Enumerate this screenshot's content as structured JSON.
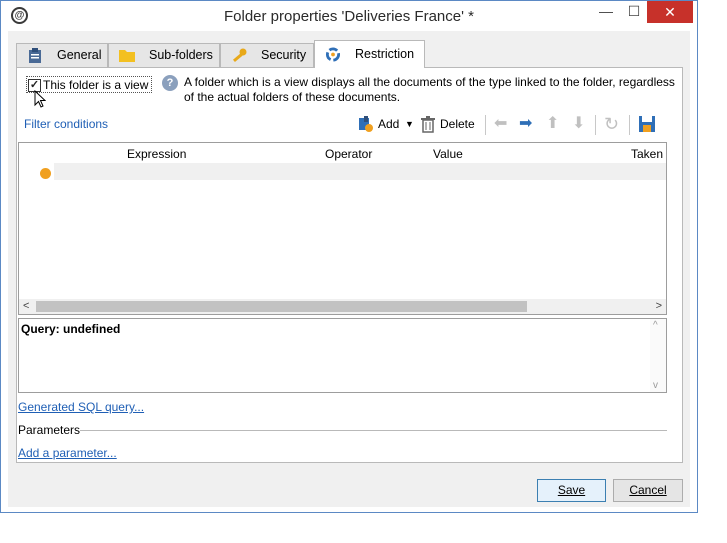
{
  "window": {
    "title": "Folder properties 'Deliveries France' *",
    "app_icon_glyph": "@",
    "minimize_glyph": "—",
    "maximize_glyph": "☐",
    "close_glyph": "✕"
  },
  "tabs": [
    {
      "label": "General",
      "icon": "clipboard-icon",
      "active": false
    },
    {
      "label": "Sub-folders",
      "icon": "folder-icon",
      "active": false
    },
    {
      "label": "Security",
      "icon": "key-icon",
      "active": false
    },
    {
      "label": "Restriction",
      "icon": "restriction-icon",
      "active": true
    }
  ],
  "restriction": {
    "view_checkbox_label": "This folder is a view",
    "view_checked": true,
    "checkbox_glyph": "✓",
    "help_glyph": "?",
    "help_text": "A folder which is a view displays all the documents of the type linked to the folder, regardless of the actual folders of these documents.",
    "filter_conditions": "Filter conditions",
    "toolbar": {
      "add_label": "Add",
      "delete_label": "Delete",
      "dropdown_glyph": "▼",
      "left_glyph": "⬅",
      "right_glyph": "➡",
      "up_glyph": "⬆",
      "down_glyph": "⬇",
      "refresh_glyph": "↻"
    },
    "grid": {
      "columns": [
        "Expression",
        "Operator",
        "Value",
        "Taken"
      ],
      "scroll_left": "<",
      "scroll_right": ">"
    },
    "query_text": "Query: undefined",
    "scroll_up": "^",
    "scroll_down": "v",
    "sql_link": "Generated SQL query...",
    "parameters_label": "Parameters",
    "add_parameter_link": "Add a parameter..."
  },
  "buttons": {
    "save": "Save",
    "cancel": "Cancel"
  },
  "colors": {
    "link": "#1f5fb5",
    "close_button": "#c7312a",
    "status_dot": "#f0a020",
    "window_border": "#5b89c4"
  }
}
